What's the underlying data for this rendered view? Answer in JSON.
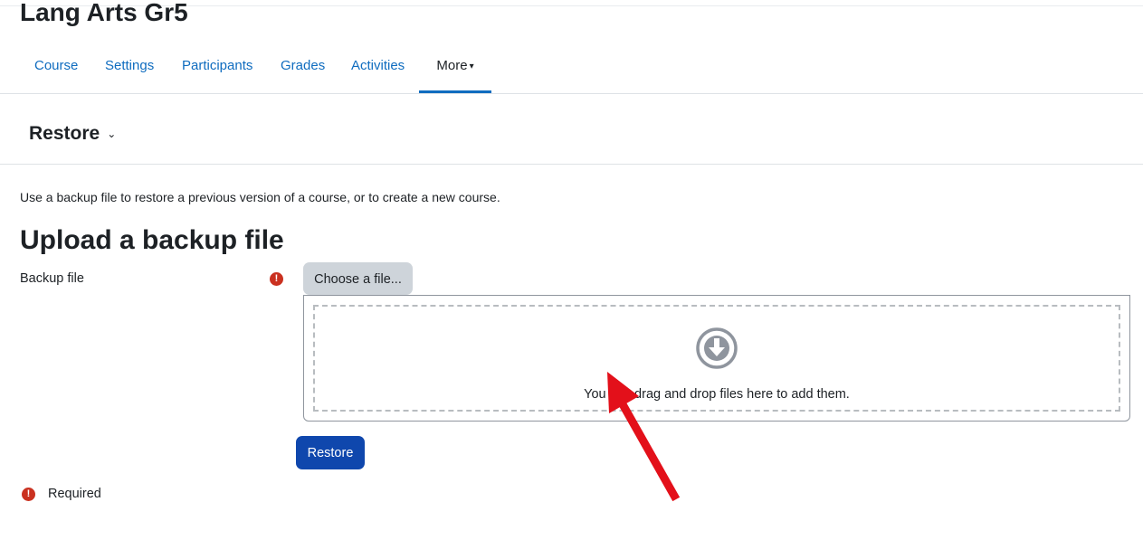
{
  "course": {
    "title": "Lang Arts Gr5"
  },
  "secondary_nav": {
    "tabs": [
      {
        "label": "Course"
      },
      {
        "label": "Settings"
      },
      {
        "label": "Participants"
      },
      {
        "label": "Grades"
      },
      {
        "label": "Activities"
      },
      {
        "label": "More",
        "active": true
      }
    ]
  },
  "tertiary_nav": {
    "selected": "Restore"
  },
  "intro_text": "Use a backup file to restore a previous version of a course, or to create a new course.",
  "form": {
    "heading": "Upload a backup file",
    "field_label": "Backup file",
    "choose_button": "Choose a file...",
    "dropzone_text": "You can drag and drop files here to add them.",
    "submit_button": "Restore",
    "required_legend": "Required",
    "required_icon": "!"
  },
  "icons": {
    "required": "exclamation-circle-icon",
    "dropzone": "arrow-circle-down-icon",
    "dropdown": "chevron-down-icon"
  },
  "colors": {
    "link": "#0f6cbf",
    "primary_button": "#0f47ad",
    "secondary_button": "#ced4da",
    "required": "#ca3120",
    "annotation_arrow": "#e3101a"
  }
}
